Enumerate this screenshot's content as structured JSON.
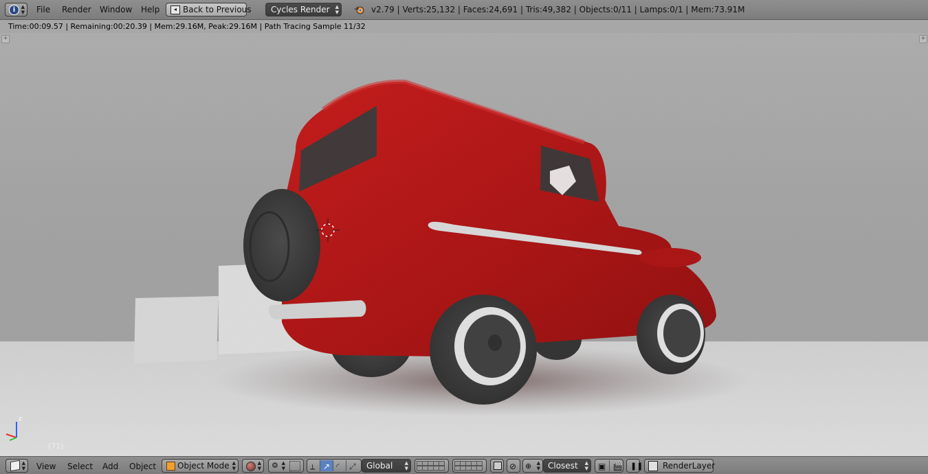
{
  "topbar": {
    "editor_type_icon": "info-icon",
    "menus": [
      "File",
      "Render",
      "Window",
      "Help"
    ],
    "back_button": "Back to Previous",
    "render_engine": "Cycles Render",
    "stats": "v2.79 | Verts:25,132 | Faces:24,691 | Tris:49,382 | Objects:0/11 | Lamps:0/1 | Mem:73.91M"
  },
  "viewport": {
    "render_status": "Time:00:09.57 | Remaining:00:20.39 | Mem:29.16M, Peak:29.16M | Path Tracing Sample 11/32",
    "frame_number": "(71)",
    "axis_labels": {
      "z": "z"
    },
    "colors": {
      "car_body": "#b01010",
      "background": "#a8a8a8",
      "floor": "#d8d8d8",
      "tire": "#3a3a3a"
    }
  },
  "bottombar": {
    "editor_type_icon": "cube-icon",
    "menus": [
      "View",
      "Select",
      "Add",
      "Object"
    ],
    "mode": "Object Mode",
    "shading_icon": "sphere-shading-icon",
    "pivot_icon": "pivot-icon",
    "orientation": "Global",
    "snap_target": "Closest",
    "render_layer": "RenderLayer"
  }
}
